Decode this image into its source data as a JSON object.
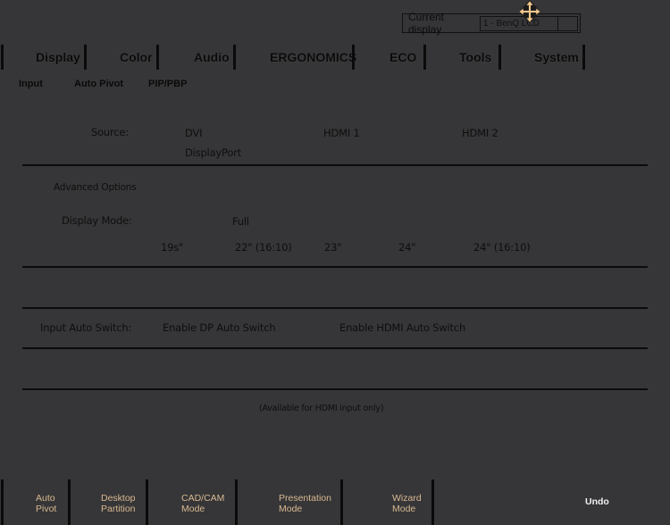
{
  "current_display": {
    "label": "Current display",
    "value": "1 - BenQ LCD"
  },
  "tabs": [
    {
      "label": "Display"
    },
    {
      "label": "Color"
    },
    {
      "label": "Audio"
    },
    {
      "label": "ERGONOMICS"
    },
    {
      "label": "ECO"
    },
    {
      "label": "Tools"
    },
    {
      "label": "System"
    }
  ],
  "subtabs": [
    {
      "label": "Input"
    },
    {
      "label": "Auto Pivot"
    },
    {
      "label": "PIP/PBP"
    }
  ],
  "source": {
    "label": "Source:",
    "options": [
      "DVI",
      "HDMI 1",
      "HDMI 2",
      "DisplayPort"
    ]
  },
  "advanced_options": {
    "label": "Advanced Options"
  },
  "display_mode": {
    "label": "Display Mode:",
    "options": [
      "Full",
      "19s\"",
      "22\" (16:10)",
      "23\"",
      "24\"",
      "24\" (16:10)"
    ]
  },
  "input_auto_switch": {
    "label": "Input Auto Switch:",
    "options": [
      "Enable DP Auto Switch",
      "Enable HDMI Auto Switch"
    ]
  },
  "note": "(Available for HDMI input only)",
  "bottom_buttons": [
    {
      "line1": "Auto",
      "line2": "Pivot"
    },
    {
      "line1": "Desktop",
      "line2": "Partition"
    },
    {
      "line1": "CAD/CAM",
      "line2": "Mode"
    },
    {
      "line1": "Presentation",
      "line2": "Mode"
    },
    {
      "line1": "Wizard",
      "line2": "Mode"
    }
  ],
  "undo_label": "Undo",
  "colors": {
    "background": "#363638",
    "text": "#0e0e0e",
    "bottom_button_text": "#d8b890",
    "undo_text": "#f0f0f0",
    "cursor_icon": "#f5c98a"
  }
}
